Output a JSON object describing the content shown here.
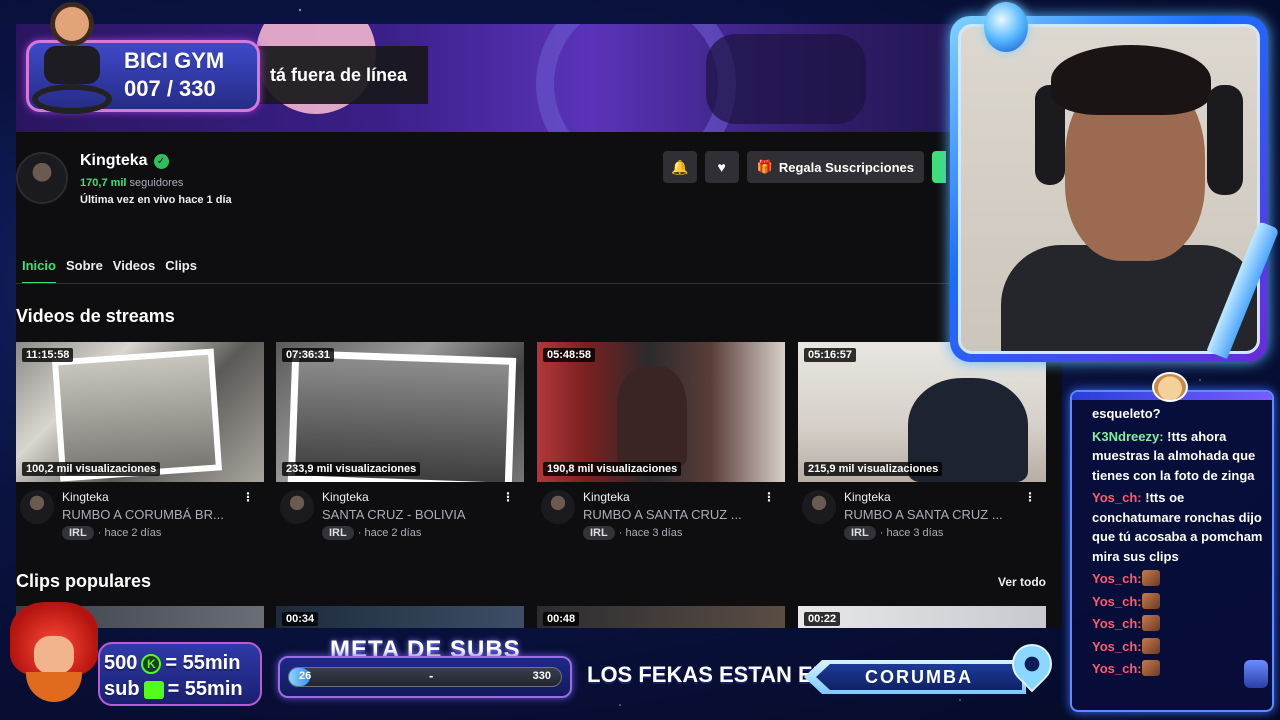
{
  "channel_page": {
    "offline_text": "tá fuera de línea",
    "name": "Kingteka",
    "verified_icon": "check-icon",
    "followers_count": "170,7 mil",
    "followers_label": "seguidores",
    "last_live": "Última vez en vivo hace 1 día",
    "gift_button": "Regala Suscripciones",
    "tabs": [
      "Inicio",
      "Sobre",
      "Videos",
      "Clips"
    ],
    "active_tab": "Inicio",
    "section_streams": "Videos de streams",
    "section_clips": "Clips populares",
    "see_all": "Ver todo",
    "videos": [
      {
        "duration": "11:15:58",
        "views": "100,2 mil visualizaciones",
        "author": "Kingteka",
        "title": "RUMBO A CORUMBÁ BR...",
        "tag": "IRL",
        "age": "· hace 2 días"
      },
      {
        "duration": "07:36:31",
        "views": "233,9 mil visualizaciones",
        "author": "Kingteka",
        "title": "SANTA CRUZ - BOLIVIA",
        "tag": "IRL",
        "age": "· hace 2 días"
      },
      {
        "duration": "05:48:58",
        "views": "190,8 mil visualizaciones",
        "author": "Kingteka",
        "title": "RUMBO A SANTA CRUZ ...",
        "tag": "IRL",
        "age": "· hace 3 días"
      },
      {
        "duration": "05:16:57",
        "views": "215,9 mil visualizaciones",
        "author": "Kingteka",
        "title": "RUMBO A SANTA CRUZ ...",
        "tag": "IRL",
        "age": "· hace 3 días"
      }
    ],
    "clips": [
      {
        "duration": ""
      },
      {
        "duration": "00:34"
      },
      {
        "duration": "00:48"
      },
      {
        "duration": "00:22"
      }
    ]
  },
  "overlay": {
    "bici_title": "BICI GYM",
    "bici_count": "007 / 330",
    "subs_line1_amount": "500",
    "subs_line1_result": "= 55min",
    "subs_line2_label": "sub",
    "subs_line2_result": "= 55min",
    "meta_title": "META DE SUBS",
    "meta_current": "26",
    "meta_separator": "-",
    "meta_goal": "330",
    "meta_progress": 0.079,
    "fekas_label": "LOS FEKAS ESTAN EN:",
    "location": "CORUMBA"
  },
  "chat": {
    "messages": [
      {
        "user": "",
        "text": "esqueleto?",
        "color": "#ffffff"
      },
      {
        "user": "K3Ndreezy:",
        "text": "!tts ahora muestras la almohada que tienes con la foto de zinga",
        "color": "#7ff0a0"
      },
      {
        "user": "Yos_ch:",
        "text": "!tts oe conchatumare ronchas dijo que tú acosaba a pomcham mira sus clips",
        "color": "#ff5b6e"
      },
      {
        "user": "Yos_ch:",
        "text": "",
        "emote": true,
        "color": "#ff5b6e"
      },
      {
        "user": "Yos_ch:",
        "text": "",
        "emote": true,
        "color": "#ff5b6e"
      },
      {
        "user": "Yos_ch:",
        "text": "",
        "emote": true,
        "color": "#ff5b6e"
      },
      {
        "user": "Yos_ch:",
        "text": "",
        "emote": true,
        "color": "#ff5b6e"
      },
      {
        "user": "Yos_ch:",
        "text": "",
        "emote": true,
        "color": "#ff5b6e"
      }
    ]
  },
  "colors": {
    "accent_green": "#3ce07a",
    "page_bg": "#0e0e10",
    "overlay_blue": "#1a2a7a"
  }
}
